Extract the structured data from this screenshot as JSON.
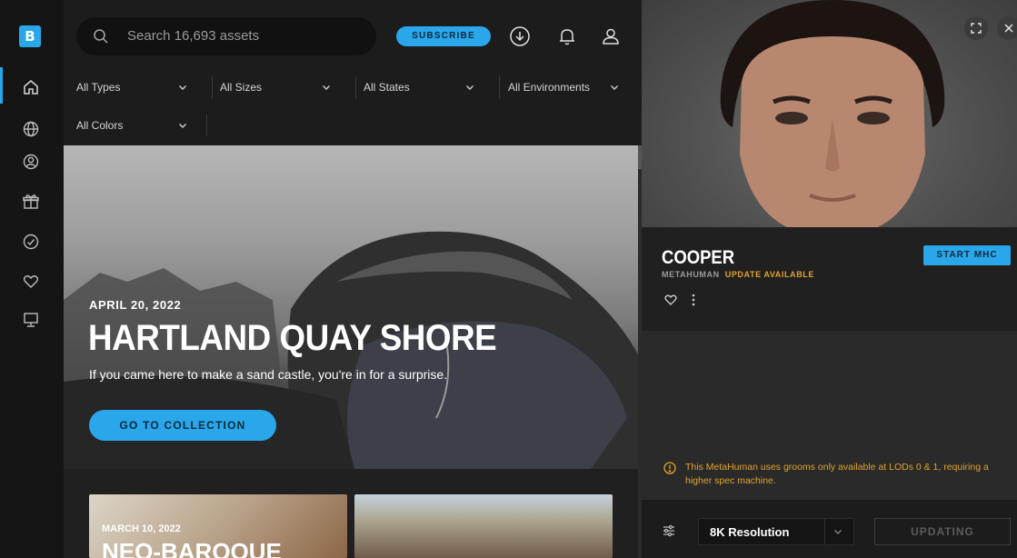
{
  "app": {
    "logo_letter": "B",
    "accent": "#2aa6ea",
    "warning_color": "#e3a22a"
  },
  "sidebar": {
    "items": [
      {
        "icon": "home-icon"
      },
      {
        "icon": "globe-icon"
      },
      {
        "icon": "person-icon"
      },
      {
        "icon": "gift-icon"
      },
      {
        "icon": "check-circle-icon"
      },
      {
        "icon": "heart-icon"
      },
      {
        "icon": "monitor-icon"
      }
    ]
  },
  "header": {
    "search_placeholder": "Search 16,693 assets",
    "subscribe_label": "SUBSCRIBE",
    "icons": [
      "download-icon",
      "bell-icon",
      "user-icon"
    ]
  },
  "filters": [
    {
      "label": "All Types"
    },
    {
      "label": "All Sizes"
    },
    {
      "label": "All States"
    },
    {
      "label": "All Environments"
    },
    {
      "label": "All Colors"
    }
  ],
  "hero": {
    "date": "APRIL 20, 2022",
    "title": "HARTLAND QUAY SHORE",
    "subtitle": "If you came here to make a sand castle, you're in for a surprise.",
    "button_label": "GO TO COLLECTION"
  },
  "cards": [
    {
      "date": "MARCH 10, 2022",
      "title": "NEO-BAROQUE"
    },
    {
      "date": "",
      "title": ""
    }
  ],
  "detail": {
    "name": "COOPER",
    "type": "METAHUMAN",
    "status": "UPDATE AVAILABLE",
    "start_label": "START MHC",
    "warning": "This MetaHuman uses grooms only available at LODs 0 & 1, requiring a higher spec machine.",
    "resolution": "8K Resolution",
    "updating_label": "UPDATING"
  }
}
